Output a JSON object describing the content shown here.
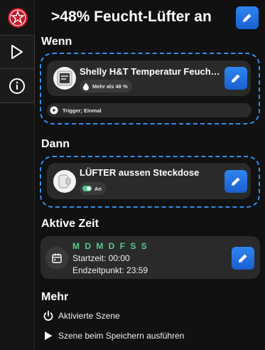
{
  "header": {
    "title": ">48% Feucht-Lüfter an"
  },
  "rail": {
    "logo_icon": "shelly-logo-icon",
    "items": [
      {
        "icon": "play-icon"
      },
      {
        "icon": "info-icon"
      }
    ]
  },
  "wenn": {
    "title": "Wenn",
    "card": {
      "device_name": "Shelly H&T Temperatur Feuch…",
      "condition": "Mehr als 48 %",
      "condition_icon": "droplet-icon"
    },
    "trigger": {
      "label": "Trigger; Einmal",
      "icon": "play-circle-icon"
    }
  },
  "dann": {
    "title": "Dann",
    "card": {
      "device_name": "LÜFTER aussen Steckdose",
      "state": "An",
      "state_icon": "toggle-on-icon"
    }
  },
  "aktive_zeit": {
    "title": "Aktive Zeit",
    "days": "M D M D F S S",
    "start": "Startzeit: 00:00",
    "end": "Endzeitpunkt: 23:59",
    "icon": "calendar-icon"
  },
  "mehr": {
    "title": "Mehr",
    "items": [
      {
        "label": "Aktivierte Szene",
        "icon": "power-icon"
      },
      {
        "label": "Szene beim Speichern ausführen",
        "icon": "play-icon"
      }
    ]
  },
  "colors": {
    "accent": "#2f8ef0",
    "days_active": "#56c98a",
    "logo": "#c0182b"
  }
}
